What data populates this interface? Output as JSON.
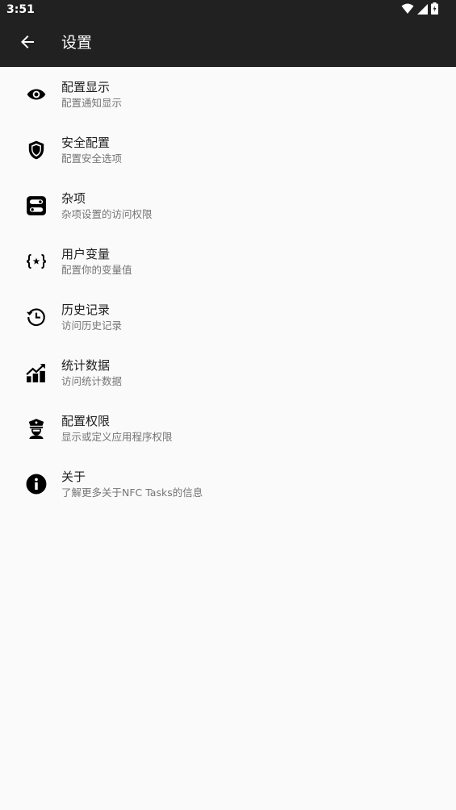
{
  "status_bar": {
    "time": "3:51",
    "icons": [
      "wifi-icon",
      "signal-icon",
      "battery-icon"
    ]
  },
  "app_bar": {
    "title": "设置",
    "back_icon": "arrow-back-icon"
  },
  "settings": {
    "items": [
      {
        "title": "配置显示",
        "subtitle": "配置通知显示",
        "icon": "eye-icon"
      },
      {
        "title": "安全配置",
        "subtitle": "配置安全选项",
        "icon": "shield-icon"
      },
      {
        "title": "杂项",
        "subtitle": "杂项设置的访问权限",
        "icon": "toggles-icon"
      },
      {
        "title": "用户变量",
        "subtitle": "配置你的变量值",
        "icon": "variable-braces-icon"
      },
      {
        "title": "历史记录",
        "subtitle": "访问历史记录",
        "icon": "history-icon"
      },
      {
        "title": "统计数据",
        "subtitle": "访问统计数据",
        "icon": "chart-icon"
      },
      {
        "title": "配置权限",
        "subtitle": "显示或定义应用程序权限",
        "icon": "police-officer-icon"
      },
      {
        "title": "关于",
        "subtitle": "了解更多关于NFC Tasks的信息",
        "icon": "info-icon"
      }
    ]
  },
  "colors": {
    "app_bar": "#212121",
    "background": "#fafafa",
    "title_text": "#1f1f1f",
    "subtitle_text": "#757575"
  }
}
